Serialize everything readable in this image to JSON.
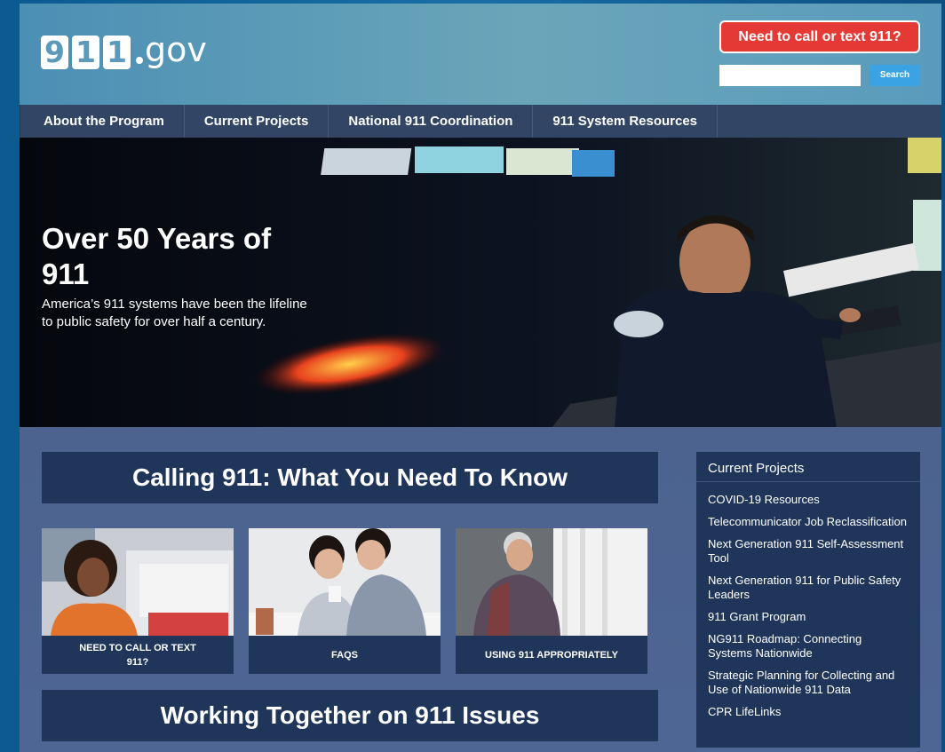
{
  "header": {
    "logo_digits": [
      "9",
      "1",
      "1"
    ],
    "logo_suffix": "gov",
    "call_button": "Need to call or text 911?",
    "search_placeholder": "",
    "search_button": "Search"
  },
  "nav": {
    "items": [
      {
        "label": "About the Program"
      },
      {
        "label": "Current Projects"
      },
      {
        "label": "National 911 Coordination"
      },
      {
        "label": "911 System Resources"
      }
    ]
  },
  "hero": {
    "title": "Over 50 Years of 911",
    "text": "America’s 911 systems have been the lifeline to public safety for over half a century."
  },
  "main": {
    "calling_title": "Calling 911: What You Need To Know",
    "cards": [
      {
        "label": "NEED TO CALL OR TEXT 911?"
      },
      {
        "label": "FAQS"
      },
      {
        "label": "USING 911 APPROPRIATELY"
      }
    ],
    "working_title": "Working Together on 911 Issues"
  },
  "sidebar": {
    "title": "Current Projects",
    "links": [
      {
        "label": "COVID-19 Resources"
      },
      {
        "label": "Telecommunicator Job Reclassification"
      },
      {
        "label": "Next Generation 911 Self-Assessment Tool"
      },
      {
        "label": "Next Generation 911 for Public Safety Leaders"
      },
      {
        "label": "911 Grant Program"
      },
      {
        "label": "NG911 Roadmap: Connecting Systems Nationwide"
      },
      {
        "label": "Strategic Planning for Collecting and Use of Nationwide 911 Data"
      },
      {
        "label": "CPR LifeLinks"
      }
    ]
  },
  "colors": {
    "call_button": "#e53935",
    "search_button": "#3aa3e3",
    "nav_bg": "#324564",
    "banner_bg": "#20355a"
  }
}
